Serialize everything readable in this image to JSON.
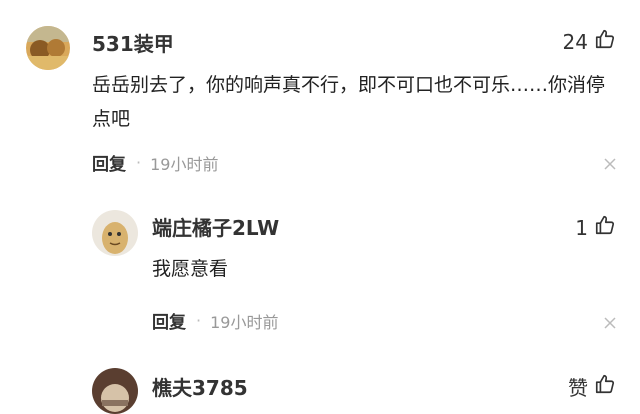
{
  "comments": [
    {
      "username": "531装甲",
      "likes": "24",
      "content": "岳岳别去了，你的响声真不行，即不可口也不可乐……你消停点吧",
      "reply_label": "回复",
      "time": "19小时前"
    },
    {
      "username": "端庄橘子2LW",
      "likes": "1",
      "content": "我愿意看",
      "reply_label": "回复",
      "time": "19小时前"
    },
    {
      "username": "樵夫3785",
      "likes": "赞"
    }
  ]
}
